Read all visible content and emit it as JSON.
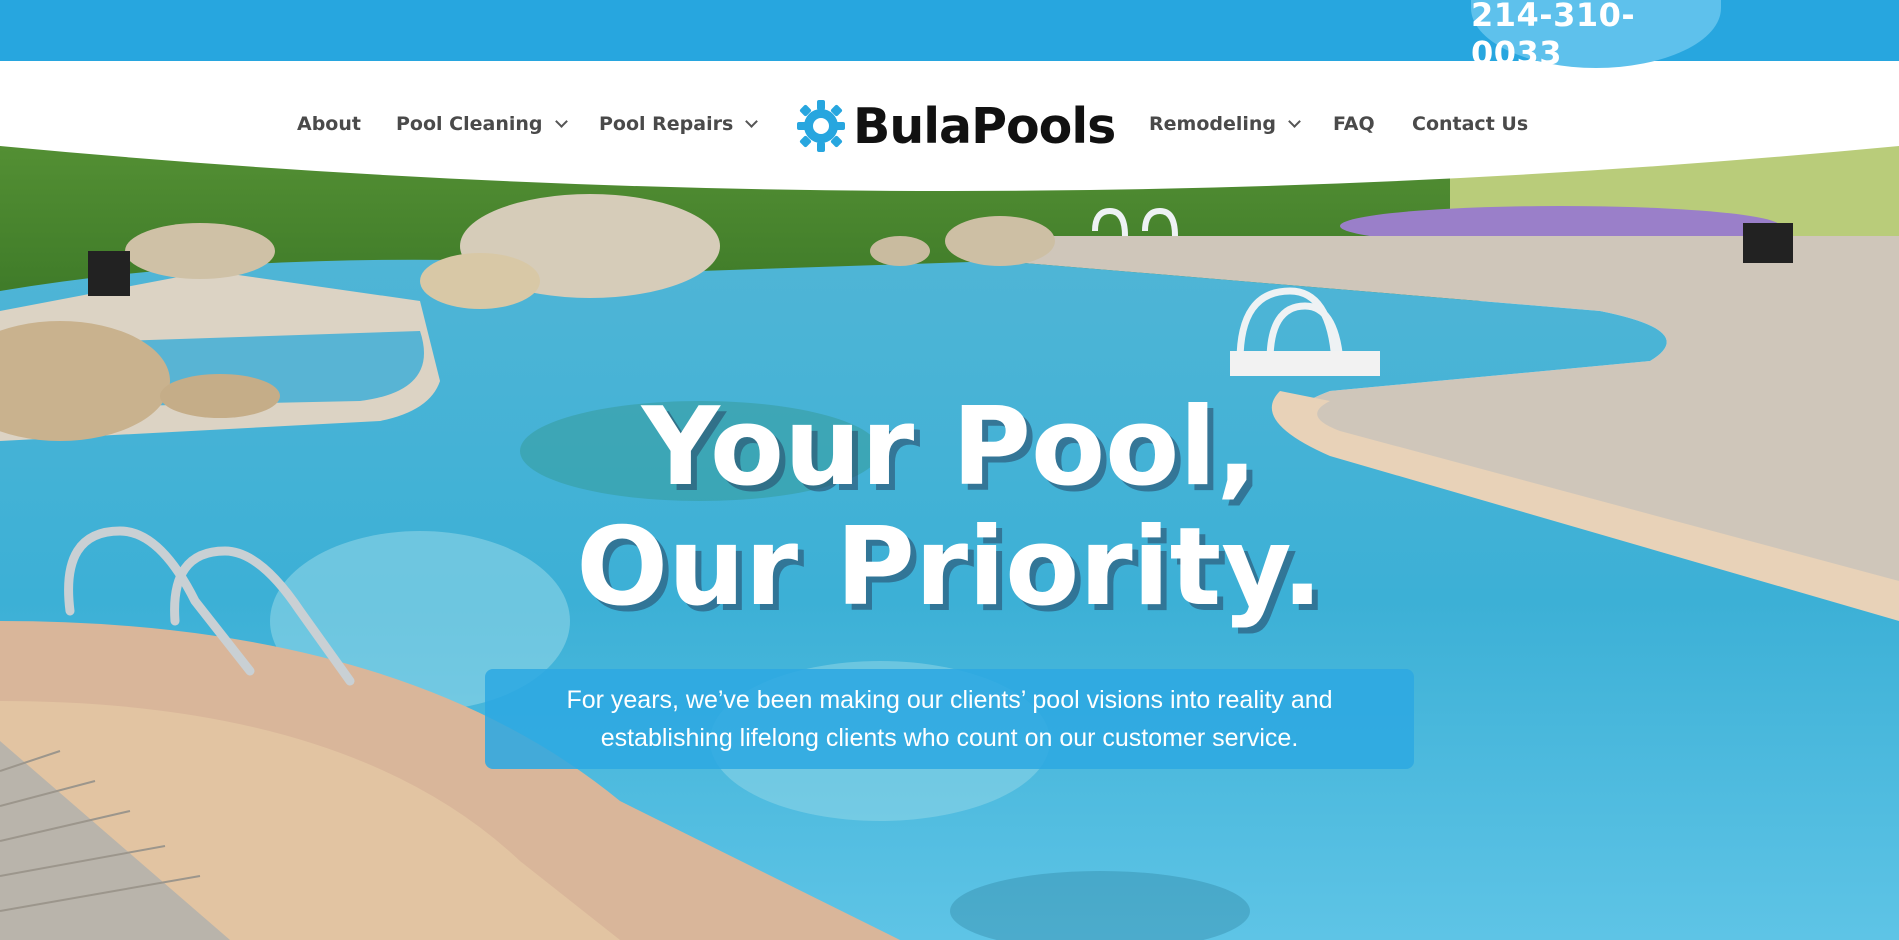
{
  "topbar": {
    "phone": "214-310-0033"
  },
  "nav": {
    "left": [
      {
        "label": "About",
        "dropdown": false
      },
      {
        "label": "Pool Cleaning",
        "dropdown": true
      },
      {
        "label": "Pool Repairs",
        "dropdown": true
      }
    ],
    "right": [
      {
        "label": "Remodeling",
        "dropdown": true
      },
      {
        "label": "FAQ",
        "dropdown": false
      },
      {
        "label": "Contact Us",
        "dropdown": false
      }
    ]
  },
  "logo": {
    "text": "BulaPools",
    "icon": "turtle-gear-icon"
  },
  "hero": {
    "headline_line1": "Your Pool,",
    "headline_line2": "Our Priority.",
    "sub_line1": "For years, we’ve been making our clients’ pool visions into reality and",
    "sub_line2": "establishing lifelong clients who count on our customer service."
  },
  "colors": {
    "brand_blue": "#27a6df",
    "phone_pill": "#5ec1ec",
    "text_dark": "#4a4a4a"
  }
}
